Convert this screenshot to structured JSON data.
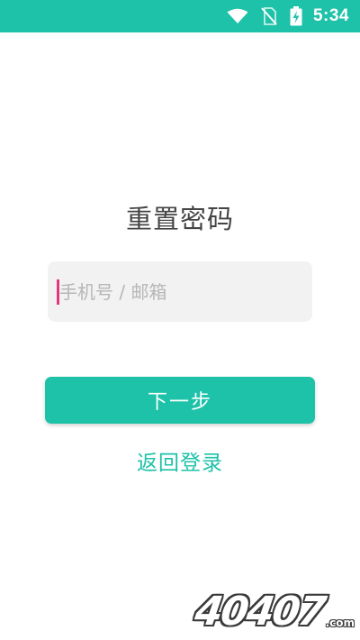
{
  "status_bar": {
    "time": "5:34",
    "icons": [
      "wifi-icon",
      "no-sim-icon",
      "battery-charging-icon"
    ],
    "background": "#1dc2a8"
  },
  "page": {
    "title": "重置密码",
    "account_input": {
      "value": "",
      "placeholder": "手机号 / 邮箱"
    },
    "next_button_label": "下一步",
    "back_to_login_label": "返回登录"
  },
  "watermark": {
    "text": "40407",
    "suffix": ".com"
  },
  "colors": {
    "accent": "#1dc2a8",
    "caret": "#e2377a",
    "input_background": "#f2f2f2",
    "title_text": "#444444"
  }
}
